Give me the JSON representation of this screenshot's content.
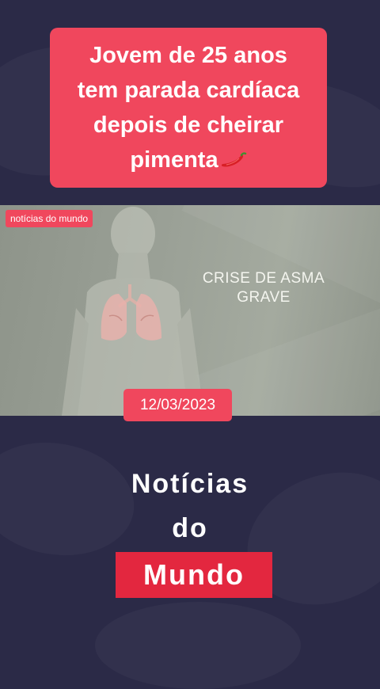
{
  "headline": {
    "text": "Jovem de 25 anos\ntem parada cardíaca\ndepois de cheirar\npimenta",
    "emoji_icon": "chili-pepper-icon"
  },
  "video": {
    "source_label": "notícias do mundo",
    "overlay_title": "CRISE DE ASMA GRAVE",
    "date": "12/03/2023"
  },
  "brand": {
    "line1": "Notícias",
    "line2": "do",
    "line3": "Mundo"
  },
  "colors": {
    "background": "#2b2a47",
    "accent_red": "#f0475d",
    "brand_red": "#e3273f"
  }
}
